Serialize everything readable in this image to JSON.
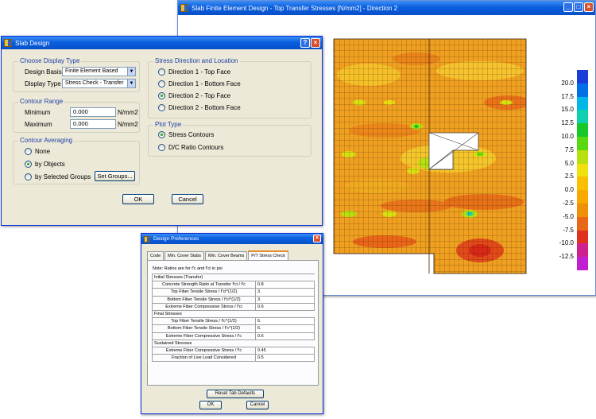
{
  "plot_window": {
    "title": "Slab Finite Element Design - Top Transfer Stresses  [N/mm2] - Direction 2",
    "legend": [
      "20.0",
      "17.5",
      "15.0",
      "12.5",
      "10.0",
      "7.5",
      "5.0",
      "2.5",
      "0.0",
      "-2.5",
      "-5.0",
      "-7.5",
      "-10.0",
      "-12.5"
    ],
    "legend_colors": [
      "#1a3cd8",
      "#0070e8",
      "#00b8e8",
      "#10d0b0",
      "#18c828",
      "#58d810",
      "#b8e010",
      "#f0e010",
      "#f8c000",
      "#f8a800",
      "#f09008",
      "#e86818",
      "#e03020",
      "#d02090",
      "#c020d0"
    ],
    "controls": [
      "_",
      "□",
      "×"
    ]
  },
  "slab_dialog": {
    "title": "Slab Design",
    "controls": [
      "?",
      "×"
    ],
    "display_type_group": {
      "title": "Choose Display Type",
      "design_basis_label": "Design Basis",
      "design_basis_value": "Finite Element Based",
      "display_type_label": "Display Type",
      "display_type_value": "Stress Check - Transfer"
    },
    "contour_range_group": {
      "title": "Contour Range",
      "minimum_label": "Minimum",
      "minimum_value": "0.000",
      "maximum_label": "Maximum",
      "maximum_value": "0.000",
      "unit": "N/mm2"
    },
    "contour_averaging_group": {
      "title": "Contour Averaging",
      "options": [
        "None",
        "by Objects",
        "by Selected Groups"
      ],
      "selected": 1,
      "set_groups_label": "Set Groups..."
    },
    "stress_direction_group": {
      "title": "Stress Direction and Location",
      "options": [
        "Direction 1  -  Top Face",
        "Direction 1  -  Bottom Face",
        "Direction 2  -  Top Face",
        "Direction 2  -  Bottom Face"
      ],
      "selected": 2
    },
    "plot_type_group": {
      "title": "Plot Type",
      "options": [
        "Stress Contours",
        "D/C Ratio Contours"
      ],
      "selected": 0
    },
    "ok_label": "OK",
    "cancel_label": "Cancel"
  },
  "pref_dialog": {
    "title": "Design Preferences",
    "tabs": [
      "Code",
      "Min. Cover Slabs",
      "Min. Cover Beams",
      "P/T Stress Check"
    ],
    "active_tab": 3,
    "note": "Note:  Ratios are for f'c and f'ci in psi",
    "rows": [
      {
        "label": "Initial Stresses (Transfer)",
        "section": true
      },
      {
        "label": "Concrete Strength Ratio at Transfer f'ci / f'c",
        "value": "0.8"
      },
      {
        "label": "Top Fiber Tensile Stress / f'ci^(1/2)",
        "value": "3."
      },
      {
        "label": "Bottom Fiber Tensile Stress / f'ci^(1/2)",
        "value": "3."
      },
      {
        "label": "Extreme Fiber Compressive Stress / f'ci",
        "value": "0.6"
      },
      {
        "label": "Final Stresses",
        "section": true
      },
      {
        "label": "Top Fiber Tensile Stress / f'c^(1/2)",
        "value": "6."
      },
      {
        "label": "Bottom Fiber Tensile Stress / f'c^(1/2)",
        "value": "6."
      },
      {
        "label": "Extreme Fiber Compressive Stress / f'c",
        "value": "0.6"
      },
      {
        "label": "Sustained Stresses",
        "section": true
      },
      {
        "label": "Extreme Fiber Compressive Stress / f'c",
        "value": "0.45"
      },
      {
        "label": "Fraction of Live Load Considered",
        "value": "0.5"
      }
    ],
    "reset_label": "Reset Tab Defaults",
    "ok_label": "OK",
    "cancel_label": "Cancel",
    "controls": [
      "×"
    ]
  }
}
